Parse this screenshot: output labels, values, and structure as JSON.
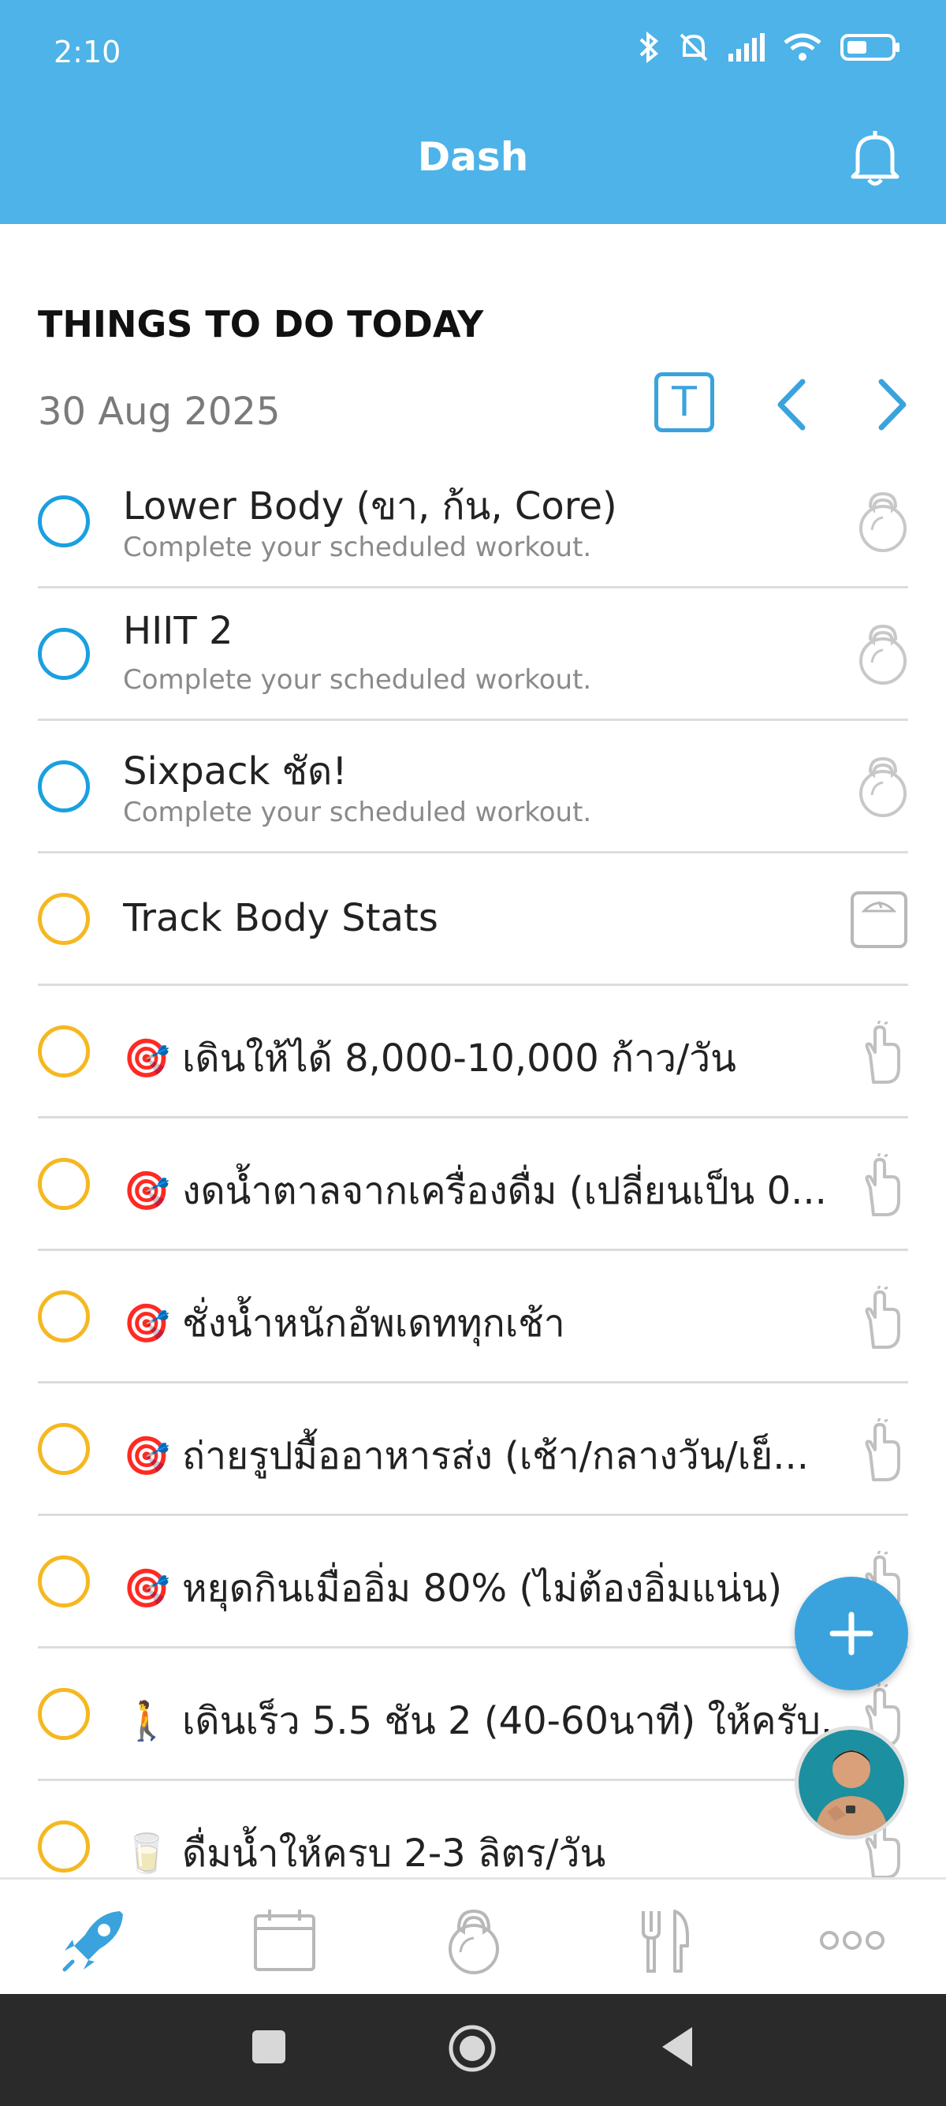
{
  "status_bar": {
    "time": "2:10"
  },
  "header": {
    "title": "Dash"
  },
  "section": {
    "title": "THINGS TO DO TODAY",
    "date": "30 Aug 2025",
    "today_button": "T"
  },
  "tasks": [
    {
      "title": "Lower Body (ขา, ก้น, Core)",
      "subtitle": "Complete your scheduled workout.",
      "status_color": "blue",
      "icon": "kettlebell-icon"
    },
    {
      "title": "HIIT 2",
      "subtitle": "Complete your scheduled workout.",
      "status_color": "blue",
      "icon": "kettlebell-icon"
    },
    {
      "title": "Sixpack ชัด!",
      "subtitle": "Complete your scheduled workout.",
      "status_color": "blue",
      "icon": "kettlebell-icon"
    },
    {
      "title": "Track Body Stats",
      "subtitle": "",
      "status_color": "yellow",
      "icon": "scale-icon"
    },
    {
      "title": "🎯 เดินให้ได้ 8,000-10,000 ก้าว/วัน",
      "subtitle": "",
      "status_color": "yellow",
      "icon": "hand-icon"
    },
    {
      "title": "🎯 งดน้ำตาลจากเครื่องดื่ม (เปลี่ยนเป็น 0...",
      "subtitle": "",
      "status_color": "yellow",
      "icon": "hand-icon"
    },
    {
      "title": "🎯 ชั่งน้ำหนักอัพเดททุกเช้า",
      "subtitle": "",
      "status_color": "yellow",
      "icon": "hand-icon"
    },
    {
      "title": "🎯 ถ่ายรูปมื้ออาหารส่ง (เช้า/กลางวัน/เย็...",
      "subtitle": "",
      "status_color": "yellow",
      "icon": "hand-icon"
    },
    {
      "title": "🎯 หยุดกินเมื่ออิ่ม 80% (ไม่ต้องอิ่มแน่น)",
      "subtitle": "",
      "status_color": "yellow",
      "icon": "hand-icon"
    },
    {
      "title": "🚶 เดินเร็ว 5.5 ชัน 2 (40-60นาที) ให้ครับ...",
      "subtitle": "",
      "status_color": "yellow",
      "icon": "hand-icon"
    },
    {
      "title": "🥛 ดื่มน้ำให้ครบ 2-3 ลิตร/วัน",
      "subtitle": "",
      "status_color": "yellow",
      "icon": "hand-icon"
    }
  ],
  "tabs": [
    "dash-rocket-icon",
    "calendar-icon",
    "kettlebell-icon",
    "fork-knife-icon",
    "more-icon"
  ],
  "colors": {
    "header": "#4db3e8",
    "accent": "#3aa3dd",
    "blue_circle": "#1aa0e0",
    "yellow_circle": "#f5b820"
  }
}
